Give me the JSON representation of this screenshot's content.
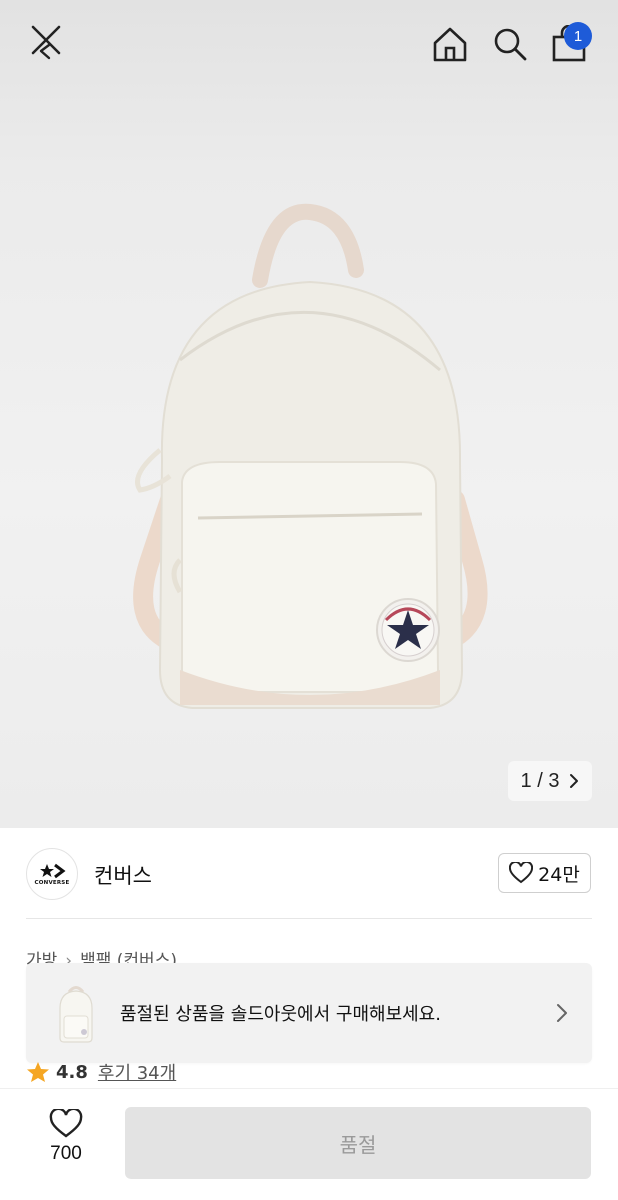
{
  "header": {
    "cart_count": "1"
  },
  "gallery": {
    "pager_text": "1 / 3"
  },
  "brand": {
    "logo_text": "CONVERSE",
    "name": "컨버스",
    "likes": "24만"
  },
  "breadcrumb": {
    "items": [
      "가방",
      "백팩 (컨버스)"
    ]
  },
  "soldout_banner": {
    "text": "품절된 상품을 솔드아웃에서 구매해보세요."
  },
  "rating": {
    "value": "4.8",
    "review_label": "후기 34개"
  },
  "bottom": {
    "wish_count": "700",
    "buy_label": "품절"
  },
  "colors": {
    "badge": "#1e5bd8",
    "star": "#f5a623",
    "disabled_button": "#e3e3e3"
  }
}
